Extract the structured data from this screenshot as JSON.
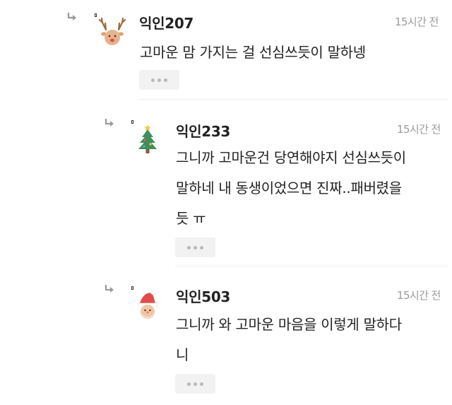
{
  "comments": [
    {
      "nickname": "익인207",
      "time": "15시간 전",
      "avatar_icon": "reindeer-icon",
      "lines": [
        "고마운 맘 가지는 걸 선심쓰듯이 말하넹"
      ]
    },
    {
      "nickname": "익인233",
      "time": "15시간 전",
      "avatar_icon": "christmas-tree-icon",
      "lines": [
        "그니까 고마운건 당연해야지 선심쓰듯이",
        "말하네 내 동생이었으면 진짜..패버렸을",
        "듯 ㅠ"
      ]
    },
    {
      "nickname": "익인503",
      "time": "15시간 전",
      "avatar_icon": "santa-icon",
      "lines": [
        "그니까 와 고마운 마음을 이렇게 말하다",
        "니"
      ]
    }
  ],
  "colors": {
    "text": "#222222",
    "muted": "#9a9a9a",
    "button_bg": "#f2f2f2",
    "divider": "#eeeeee"
  }
}
